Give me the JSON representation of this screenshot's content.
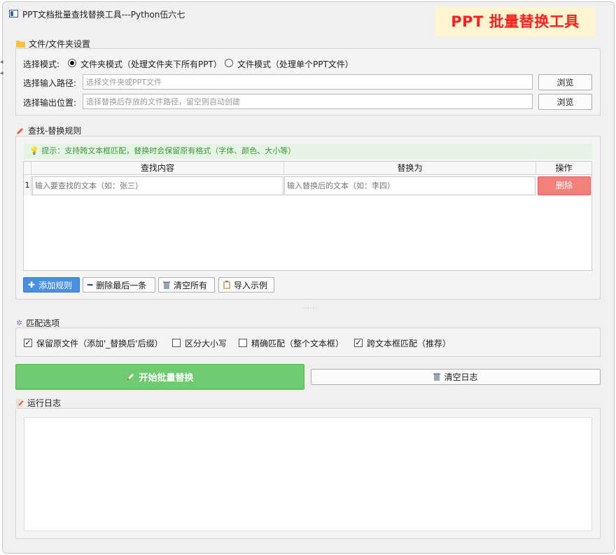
{
  "window": {
    "title": "PPT文档批量查找替换工具---Python伍六七",
    "brand": "PPT 批量替换工具"
  },
  "file_section": {
    "title": "文件/文件夹设置",
    "mode_label": "选择模式:",
    "modes": [
      {
        "label": "文件夹模式（处理文件夹下所有PPT）",
        "selected": true
      },
      {
        "label": "文件模式（处理单个PPT文件）",
        "selected": false
      }
    ],
    "input_label": "选择输入路径:",
    "input_placeholder": "选择文件夹或PPT文件",
    "output_label": "选择输出位置:",
    "output_placeholder": "选择替换后存放的文件路径，留空则自动创建",
    "browse_label": "浏览"
  },
  "rules_section": {
    "title": "查找-替换规则",
    "hint": "提示：支持跨文本框匹配，替换时会保留原有格式（字体、颜色、大小等）",
    "columns": [
      "查找内容",
      "替换为",
      "操作"
    ],
    "rows": [
      {
        "index": "1",
        "find_placeholder": "输入要查找的文本（如：张三）",
        "replace_placeholder": "输入替换后的文本（如：李四）",
        "action": "删除"
      }
    ],
    "buttons": {
      "add": "添加规则",
      "remove_last": "删除最后一条",
      "clear_all": "清空所有",
      "import_example": "导入示例"
    }
  },
  "match_section": {
    "title": "匹配选项",
    "options": [
      {
        "label": "保留原文件（添加'_替换后'后缀）",
        "checked": true
      },
      {
        "label": "区分大小写",
        "checked": false
      },
      {
        "label": "精确匹配（整个文本框）",
        "checked": false
      },
      {
        "label": "跨文本框匹配（推荐）",
        "checked": true
      }
    ]
  },
  "actions": {
    "start": "开始批量替换",
    "clear_log": "清空日志"
  },
  "log_section": {
    "title": "运行日志"
  },
  "colors": {
    "brand_red": "#ff1f1f",
    "brand_bg": "#fff5d1",
    "start_green": "#6fcb6f",
    "delete_red": "#f2817c",
    "add_blue": "#4a90e2",
    "hint_green": "#3a9a3a"
  },
  "icons": [
    "folder-icon",
    "pencil-icon",
    "bulb-icon",
    "plus-icon",
    "minus-icon",
    "trash-icon",
    "clipboard-icon",
    "gear-icon",
    "rocket-icon",
    "log-icon"
  ]
}
